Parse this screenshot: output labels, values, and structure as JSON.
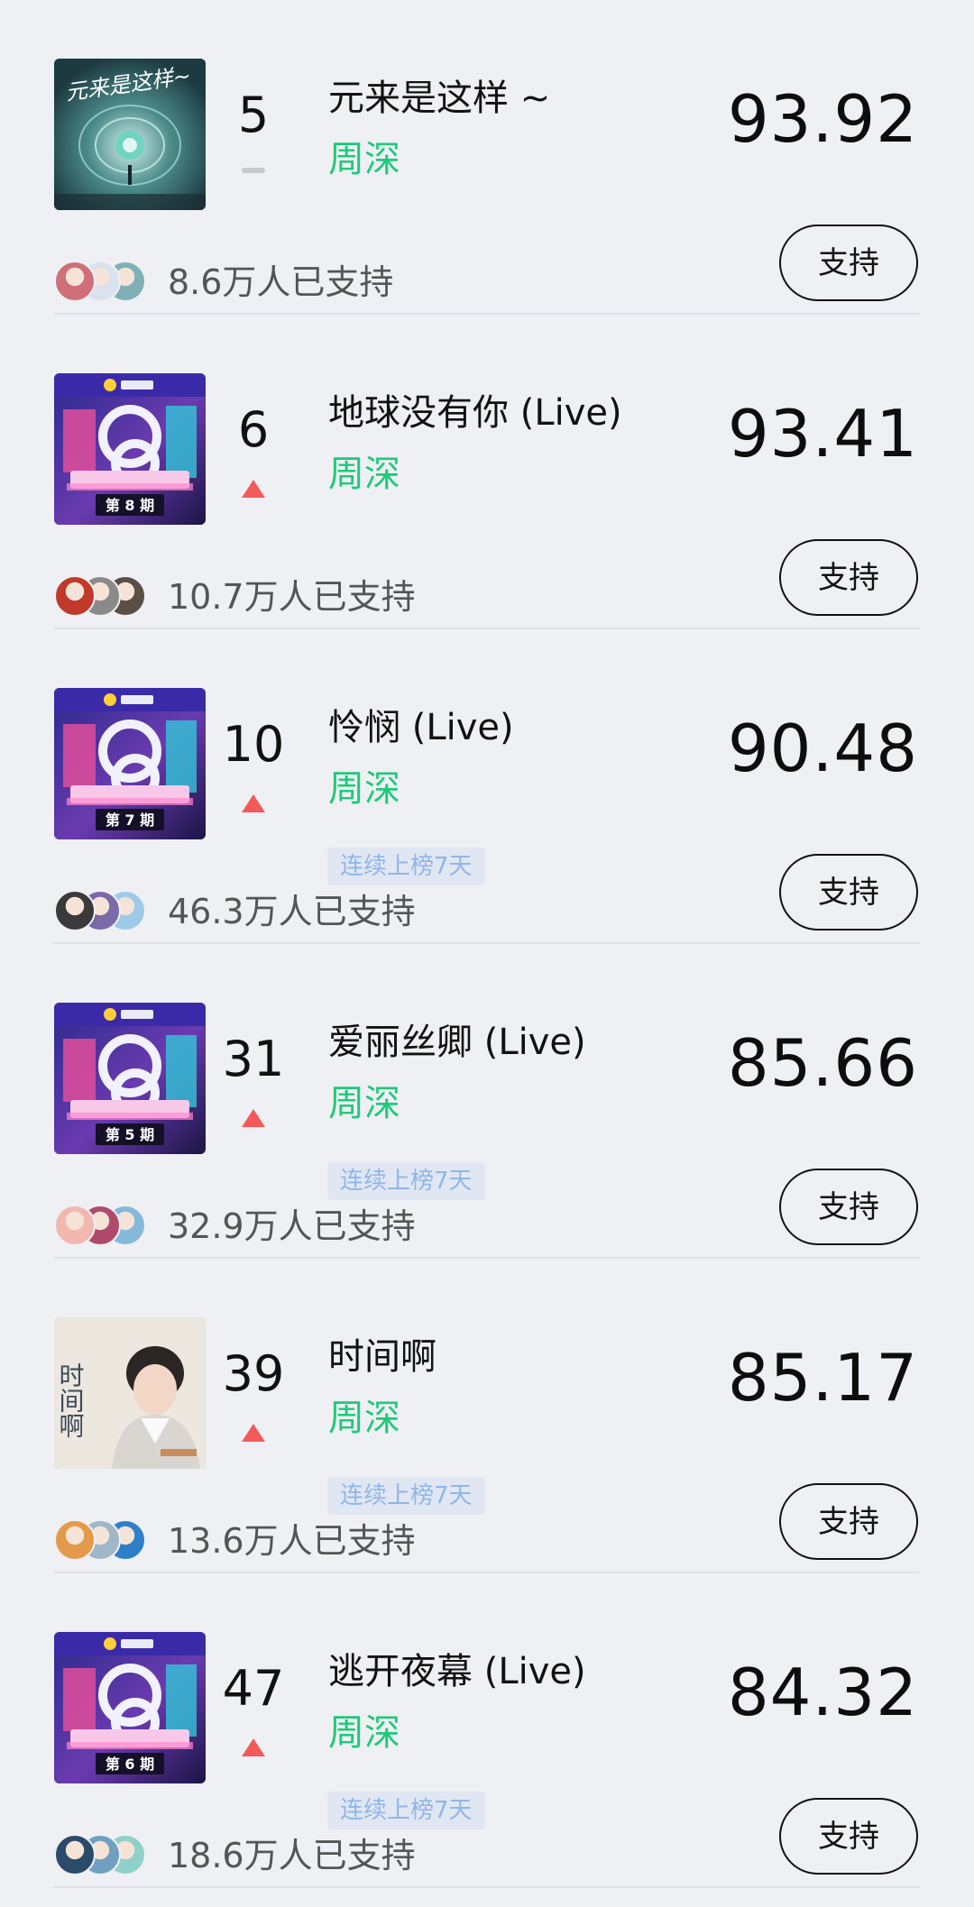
{
  "colors": {
    "background": "#eff0f4",
    "artist": "#1fc97a",
    "trend_up": "#f25a5a",
    "trend_flat": "#c9c9c9",
    "badge_bg": "#e1e7f2",
    "badge_text": "#8fb6e8"
  },
  "button_label": "支持",
  "entries": [
    {
      "rank": "5",
      "trend": "flat",
      "title": "元来是这样 ~",
      "artist": "周深",
      "badge": "",
      "score": "93.92",
      "supporters": "8.6万人已支持",
      "cover": "sci-fi",
      "cover_text": "元来是这样~",
      "avatars": [
        "#d06f7a",
        "#d9e2ee",
        "#7fb0b8"
      ]
    },
    {
      "rank": "6",
      "trend": "up",
      "title": "地球没有你 (Live)",
      "artist": "周深",
      "badge": "",
      "score": "93.41",
      "supporters": "10.7万人已支持",
      "cover": "show",
      "cover_text": "第 8 期",
      "avatars": [
        "#c0392b",
        "#8a8a8a",
        "#5a4e46"
      ]
    },
    {
      "rank": "10",
      "trend": "up",
      "title": "怜悯 (Live)",
      "artist": "周深",
      "badge": "连续上榜7天",
      "score": "90.48",
      "supporters": "46.3万人已支持",
      "cover": "show",
      "cover_text": "第 7 期",
      "avatars": [
        "#3a3a3a",
        "#7b6aa8",
        "#9ccbe8"
      ]
    },
    {
      "rank": "31",
      "trend": "up",
      "title": "爱丽丝卿 (Live)",
      "artist": "周深",
      "badge": "连续上榜7天",
      "score": "85.66",
      "supporters": "32.9万人已支持",
      "cover": "show",
      "cover_text": "第 5 期",
      "avatars": [
        "#f2b8b0",
        "#b04a6a",
        "#86b9d9"
      ]
    },
    {
      "rank": "39",
      "trend": "up",
      "title": "时间啊",
      "artist": "周深",
      "badge": "连续上榜7天",
      "score": "85.17",
      "supporters": "13.6万人已支持",
      "cover": "portrait",
      "cover_text": "时间啊",
      "avatars": [
        "#e39a4a",
        "#9fb7c7",
        "#2f7fc8"
      ]
    },
    {
      "rank": "47",
      "trend": "up",
      "title": "逃开夜幕 (Live)",
      "artist": "周深",
      "badge": "连续上榜7天",
      "score": "84.32",
      "supporters": "18.6万人已支持",
      "cover": "show",
      "cover_text": "第 6 期",
      "avatars": [
        "#2c4a6a",
        "#6fa0c0",
        "#8fd0c8"
      ]
    }
  ]
}
